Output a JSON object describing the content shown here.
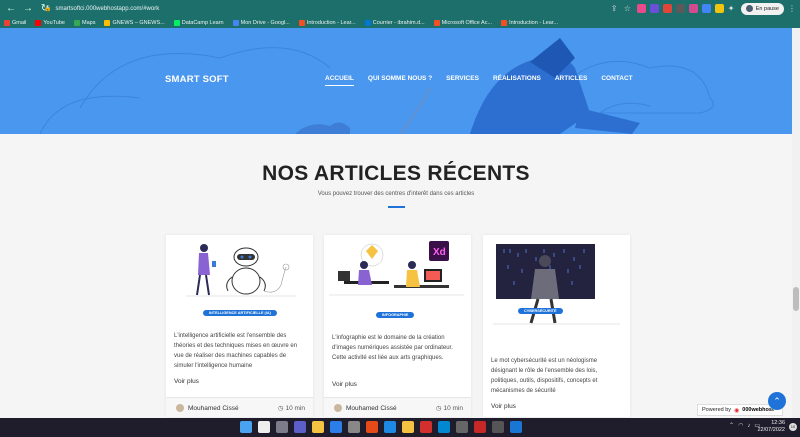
{
  "browser": {
    "url": "smartsoftci.000webhostapp.com/#work",
    "profile_label": "En pause",
    "bookmarks": [
      {
        "label": "Gmail",
        "color": "#ea4335"
      },
      {
        "label": "YouTube",
        "color": "#ff0000"
      },
      {
        "label": "Maps",
        "color": "#34a853"
      },
      {
        "label": "GNEWS – GNEWS...",
        "color": "#fbbc05"
      },
      {
        "label": "DataCamp Learn",
        "color": "#03ef62"
      },
      {
        "label": "Mon Drive - Googl...",
        "color": "#4285f4"
      },
      {
        "label": "Introduction - Lear...",
        "color": "#f25022"
      },
      {
        "label": "Courrier - ibrahim.d...",
        "color": "#0078d4"
      },
      {
        "label": "Microsoft Office Ac...",
        "color": "#f25022"
      },
      {
        "label": "Introduction - Lear...",
        "color": "#f25022"
      }
    ]
  },
  "header": {
    "logo": "SMART SOFT",
    "menu": [
      {
        "label": "ACCUEIL",
        "active": true
      },
      {
        "label": "QUI SOMME NOUS ?",
        "active": false
      },
      {
        "label": "SERVICES",
        "active": false
      },
      {
        "label": "RÉALISATIONS",
        "active": false
      },
      {
        "label": "ARTICLES",
        "active": false
      },
      {
        "label": "CONTACT",
        "active": false
      }
    ]
  },
  "section": {
    "title": "NOS ARTICLES RÉCENTS",
    "subtitle": "Vous pouvez trouver des centres d'interêt dans ces articles"
  },
  "cards": [
    {
      "badge": "INTELLIGENCE ARTIFICIELLE (IA)",
      "text": "L'intelligence artificielle est l'ensemble des théories et des techniques mises en œuvre en vue de réaliser des machines capables de simuler l'intelligence humaine",
      "more": "Voir plus",
      "author": "Mouhamed Cissé",
      "time": "10 min"
    },
    {
      "badge": "INFOGRAPHIE",
      "text": "L'infographie est le domaine de la création d'images numériques assistée par ordinateur. Cette activité est liée aux arts graphiques.",
      "more": "Voir plus",
      "author": "Mouhamed Cissé",
      "time": "10 min",
      "art_label": "Xd"
    },
    {
      "badge": "CYBERSÉCURITÉ",
      "text": "Le mot cybersécurité est un néologisme désignant le rôle de l'ensemble des lois, politiques, outils, dispositifs, concepts et mécanismes de sécurité",
      "more": "Voir plus"
    }
  ],
  "footer": {
    "powered_by": "Powered by",
    "host": "000webhost"
  },
  "taskbar": {
    "time": "12:36",
    "date": "22/07/2022",
    "notifications": "10"
  },
  "colors": {
    "accent": "#1f73d8",
    "hero": "#4a97f0",
    "browser": "#1d6f6c"
  }
}
